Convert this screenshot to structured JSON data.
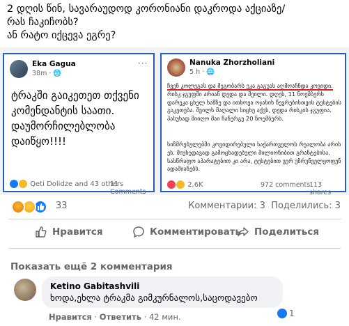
{
  "post": {
    "text_line1": "2 დღის წინ, სავარაუდოდ კორონიანი დაკროდა  აქციაზე/",
    "text_line2": "რას ჩაკიჩობს?",
    "text_line3": "ან რატო იქცევა ეგრე?"
  },
  "left_card": {
    "author": "Eka Gagua",
    "time": "38m · ",
    "body": "ტრაკში გაიკეთეთ თქვენი კომენდანტის საათი. დაუმორჩილებლობა დაიწყო!!!!",
    "likers": "Qeti Dolidze and 43 others",
    "comments": "11 Comments"
  },
  "right_card": {
    "author": "Nanuka Zhorzholiani",
    "time": "5 h · ",
    "para1_underlined": "ჩვენ კოლეგას და მეგობარს ეკა გაგუას აღმოაჩნდა კოვიდი.",
    "para1_rest": " რისკ ჯგუფში არიან დედა და მეილი. დღეს, 11 ნოემბერს დარეკა ცხელ ხაზზე და ითხოვა ოჯახის წევრებისთვის ტესტების გაკეთება. შვილს მაღალი სიცხე აქვს, დედა რისკის ჯგუფია. პასუხად მიიღო მაი ჩანერგე 20 ნოემბერს.",
    "para2": "სიზმრებულებში კოვიდირებული საქართველოს რეალობა არის ეს. მიუხედავად  გამოცხადებული მილიონიბით გრანტებისა, სასწრაფო აპარატებით კი არა, ტესტებით ვერ უზრუნველყოფენ ადამიანებს.",
    "reacts": "2,6K",
    "comments": "972 comments",
    "shares": "113 shares"
  },
  "stats": {
    "reaction_count": "33",
    "comments": "Комментарии: 3",
    "shares": "Поделились: 3"
  },
  "actions": {
    "like": "Нравится",
    "comment": "Комментировать",
    "share": "Поделиться"
  },
  "more_comments": "Показать ещё 2 комментария",
  "comment": {
    "author": "Ketino Gabitashvili",
    "text": "ხოდა,ეხლა ტრაკმა გიმკურნალოს,საცოდავებო",
    "reaction_count": "1",
    "like_label": "Нравится",
    "sep1": " · ",
    "reply_label": "Ответить",
    "sep2": " · ",
    "time": "42 мин."
  },
  "colors": {
    "facebook_blue": "#1877f2",
    "text_gray": "#65676b",
    "bubble_bg": "#f0f2f5"
  }
}
